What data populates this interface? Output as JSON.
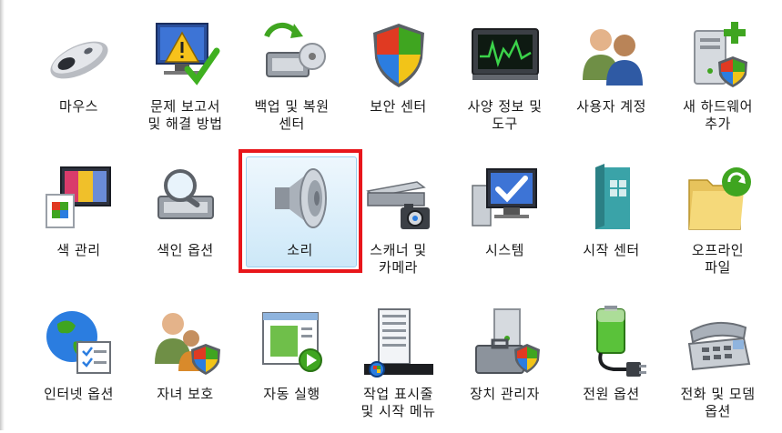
{
  "control_panel": {
    "items": [
      {
        "label": "마우스",
        "icon": "mouse-icon"
      },
      {
        "label": "문제 보고서\n및 해결 방법",
        "icon": "problem-reports-icon"
      },
      {
        "label": "백업 및 복원\n센터",
        "icon": "backup-restore-icon"
      },
      {
        "label": "보안 센터",
        "icon": "security-center-icon"
      },
      {
        "label": "사양 정보 및\n도구",
        "icon": "performance-info-icon"
      },
      {
        "label": "사용자 계정",
        "icon": "user-accounts-icon"
      },
      {
        "label": "새 하드웨어\n추가",
        "icon": "add-hardware-icon"
      },
      {
        "label": "색 관리",
        "icon": "color-management-icon"
      },
      {
        "label": "색인 옵션",
        "icon": "indexing-options-icon"
      },
      {
        "label": "소리",
        "icon": "speaker-icon"
      },
      {
        "label": "스캐너 및\n카메라",
        "icon": "scanner-camera-icon"
      },
      {
        "label": "시스템",
        "icon": "system-icon"
      },
      {
        "label": "시작 센터",
        "icon": "welcome-center-icon"
      },
      {
        "label": "오프라인\n파일",
        "icon": "offline-files-icon"
      },
      {
        "label": "인터넷 옵션",
        "icon": "internet-options-icon"
      },
      {
        "label": "자녀 보호",
        "icon": "parental-controls-icon"
      },
      {
        "label": "자동 실행",
        "icon": "autoplay-icon"
      },
      {
        "label": "작업 표시줄\n및 시작 메뉴",
        "icon": "taskbar-start-menu-icon"
      },
      {
        "label": "장치 관리자",
        "icon": "device-manager-icon"
      },
      {
        "label": "전원 옵션",
        "icon": "power-options-icon"
      },
      {
        "label": "전화 및 모뎀\n옵션",
        "icon": "phone-modem-icon"
      }
    ],
    "selected_index": 9,
    "colors": {
      "selection_border": "#e8161b",
      "selection_fill": "#cde8f8"
    }
  }
}
